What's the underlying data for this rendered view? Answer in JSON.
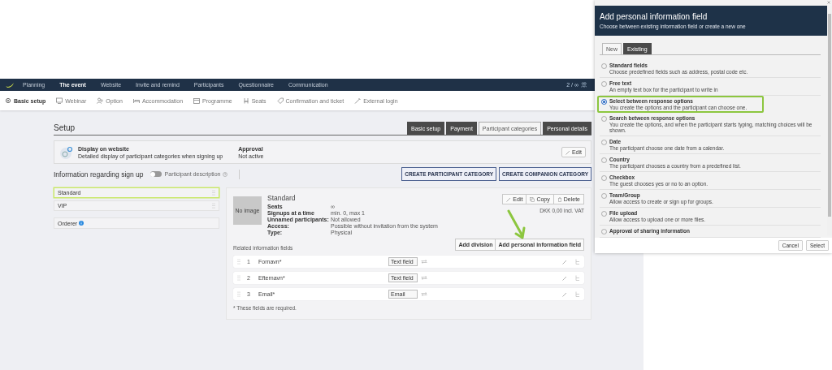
{
  "top_nav": {
    "items": [
      {
        "label": "Planning",
        "selected": false
      },
      {
        "label": "The event",
        "selected": true
      },
      {
        "label": "Website",
        "selected": false
      },
      {
        "label": "Invite and remind",
        "selected": false
      },
      {
        "label": "Participants",
        "selected": false
      },
      {
        "label": "Questionnaire",
        "selected": false
      },
      {
        "label": "Communication",
        "selected": false
      }
    ],
    "counter": "2 / ∞"
  },
  "sub_nav": {
    "items": [
      {
        "label": "Basic setup",
        "selected": true
      },
      {
        "label": "Webinar",
        "selected": false
      },
      {
        "label": "Option",
        "selected": false
      },
      {
        "label": "Accommodation",
        "selected": false
      },
      {
        "label": "Programme",
        "selected": false
      },
      {
        "label": "Seats",
        "selected": false
      },
      {
        "label": "Confirmation and ticket",
        "selected": false
      },
      {
        "label": "External login",
        "selected": false
      }
    ]
  },
  "page": {
    "title": "Setup",
    "tabs": [
      {
        "label": "Basic setup",
        "selected": false
      },
      {
        "label": "Payment",
        "selected": false
      },
      {
        "label": "Participant categories",
        "selected": true
      },
      {
        "label": "Personal details",
        "selected": false
      }
    ],
    "display_card": {
      "title": "Display on website",
      "description": "Detailed display of participant categories when signing up",
      "approval_label": "Approval",
      "approval_value": "Not active",
      "edit_button": "Edit"
    },
    "info_heading": "Information regarding sign up",
    "participant_description": {
      "label": "Participant description",
      "on": false
    },
    "buttons": [
      "CREATE PARTICIPANT CATEGORY",
      "CREATE COMPANION CATEGORY"
    ],
    "categories": [
      {
        "name": "Standard",
        "selected": true
      },
      {
        "name": "VIP",
        "selected": false
      }
    ],
    "orderer": "Orderer",
    "detail": {
      "image_placeholder": "No image",
      "name": "Standard",
      "properties": [
        {
          "label": "Seats",
          "value": "∞"
        },
        {
          "label": "Signups at a time",
          "value": "min. 0, max 1"
        },
        {
          "label": "Unnamed participants:",
          "value": "Not allowed"
        },
        {
          "label": "Access:",
          "value": "Possible without invitation from the system"
        },
        {
          "label": "Type:",
          "value": "Physical"
        }
      ],
      "actions": [
        "Edit",
        "Copy",
        "Delete"
      ],
      "price": "DKK 0,00 incl. VAT",
      "related_label": "Related information fields",
      "field_buttons": [
        "Add division",
        "Add personal information field"
      ],
      "fields": [
        {
          "number": "1",
          "name": "Fornavn*",
          "type": "Text field"
        },
        {
          "number": "2",
          "name": "Efternavn*",
          "type": "Text field"
        },
        {
          "number": "3",
          "name": "Email*",
          "type": "Email"
        }
      ],
      "footnote": "* These fields are required."
    }
  },
  "dialog": {
    "title": "Add personal information field",
    "subtitle": "Choose between existing information field or create a new one",
    "tabs": [
      {
        "label": "New",
        "selected": true
      },
      {
        "label": "Existing",
        "selected": false
      }
    ],
    "options": [
      {
        "title": "Standard fields",
        "description": "Choose predefined fields such as address, postal code etc.",
        "selected": false
      },
      {
        "title": "Free text",
        "description": "An empty text box for the participant to write in",
        "selected": false
      },
      {
        "title": "Select between response options",
        "description": "You create the options and the participant can choose one.",
        "selected": true
      },
      {
        "title": "Search between response options",
        "description": "You create the options, and when the participant starts typing, matching choices will be shown.",
        "selected": false
      },
      {
        "title": "Date",
        "description": "The participant choose one date from a calendar.",
        "selected": false
      },
      {
        "title": "Country",
        "description": "The participant chooses a country from a predefined list.",
        "selected": false
      },
      {
        "title": "Checkbox",
        "description": "The guest chooses yes or no to an option.",
        "selected": false
      },
      {
        "title": "Team/Group",
        "description": "Allow access to create or sign up for groups.",
        "selected": false
      },
      {
        "title": "File upload",
        "description": "Allow access to upload one or more files.",
        "selected": false
      },
      {
        "title": "Approval of sharing information",
        "selected": false
      }
    ],
    "buttons": [
      "Cancel",
      "Select"
    ]
  }
}
